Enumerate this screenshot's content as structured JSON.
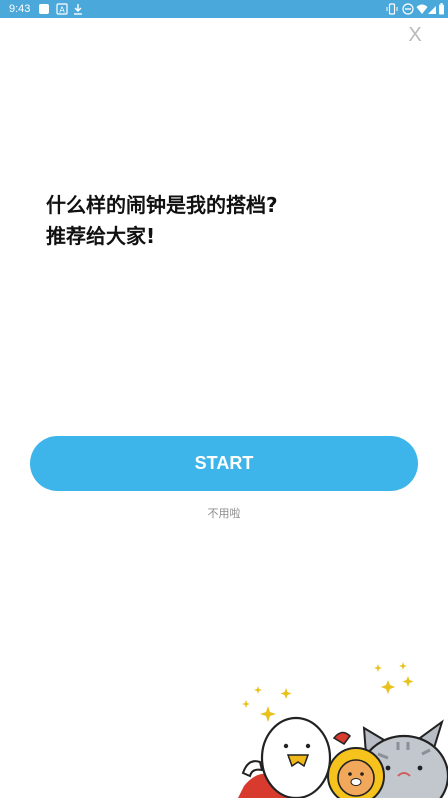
{
  "status_bar": {
    "time": "9:43",
    "left_icons": [
      "white-square-icon",
      "a-box-icon",
      "download-icon"
    ],
    "right_icons": [
      "vibrate-icon",
      "dnd-icon",
      "wifi-icon",
      "signal-icon",
      "battery-icon"
    ]
  },
  "close_label": "X",
  "headline": {
    "line1": "什么样的闹钟是我的搭档?",
    "line2": "推荐给大家!"
  },
  "start_button": {
    "label": "START"
  },
  "skip_link": {
    "label": "不用啦"
  },
  "colors": {
    "status_bar": "#4aa8da",
    "accent": "#3eb5ea",
    "close_icon": "#b9b9b9",
    "skip_text": "#8c8c8c"
  },
  "illustration": [
    "white-bird-character-icon",
    "lion-character-icon",
    "gray-cat-character-icon",
    "sparkle-icon"
  ]
}
